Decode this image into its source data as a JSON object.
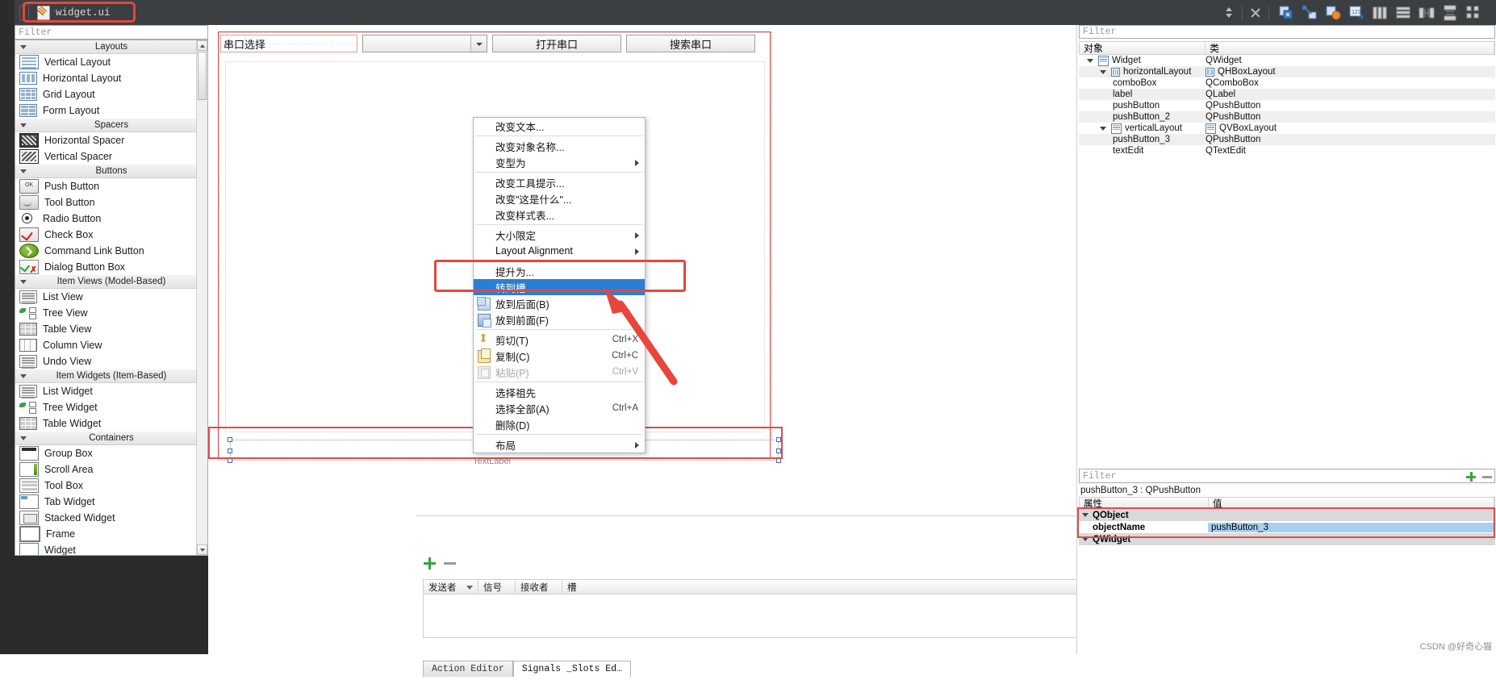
{
  "toolbar": {
    "file_name": "widget.ui",
    "icons": [
      "spin-updown",
      "close",
      "edit-widgets",
      "edit-signals-slots",
      "edit-buddies",
      "edit-tab-order",
      "layout-horizontal",
      "layout-vertical",
      "layout-splitter-h",
      "layout-splitter-v",
      "layout-grid",
      "layout-form",
      "break-layout"
    ]
  },
  "widget_box": {
    "filter_placeholder": "Filter",
    "groups": [
      {
        "title": "Layouts",
        "items": [
          {
            "label": "Vertical Layout",
            "icon": "vertical-layout-icon"
          },
          {
            "label": "Horizontal Layout",
            "icon": "horizontal-layout-icon"
          },
          {
            "label": "Grid Layout",
            "icon": "grid-layout-icon"
          },
          {
            "label": "Form Layout",
            "icon": "form-layout-icon"
          }
        ]
      },
      {
        "title": "Spacers",
        "items": [
          {
            "label": "Horizontal Spacer",
            "icon": "horizontal-spacer-icon"
          },
          {
            "label": "Vertical Spacer",
            "icon": "vertical-spacer-icon"
          }
        ]
      },
      {
        "title": "Buttons",
        "items": [
          {
            "label": "Push Button",
            "icon": "push-button-icon"
          },
          {
            "label": "Tool Button",
            "icon": "tool-button-icon"
          },
          {
            "label": "Radio Button",
            "icon": "radio-button-icon"
          },
          {
            "label": "Check Box",
            "icon": "check-box-icon"
          },
          {
            "label": "Command Link Button",
            "icon": "command-link-button-icon"
          },
          {
            "label": "Dialog Button Box",
            "icon": "dialog-button-box-icon"
          }
        ]
      },
      {
        "title": "Item Views (Model-Based)",
        "items": [
          {
            "label": "List View",
            "icon": "list-view-icon"
          },
          {
            "label": "Tree View",
            "icon": "tree-view-icon"
          },
          {
            "label": "Table View",
            "icon": "table-view-icon"
          },
          {
            "label": "Column View",
            "icon": "column-view-icon"
          },
          {
            "label": "Undo View",
            "icon": "undo-view-icon"
          }
        ]
      },
      {
        "title": "Item Widgets (Item-Based)",
        "items": [
          {
            "label": "List Widget",
            "icon": "list-widget-icon"
          },
          {
            "label": "Tree Widget",
            "icon": "tree-widget-icon"
          },
          {
            "label": "Table Widget",
            "icon": "table-widget-icon"
          }
        ]
      },
      {
        "title": "Containers",
        "items": [
          {
            "label": "Group Box",
            "icon": "group-box-icon"
          },
          {
            "label": "Scroll Area",
            "icon": "scroll-area-icon"
          },
          {
            "label": "Tool Box",
            "icon": "tool-box-icon"
          },
          {
            "label": "Tab Widget",
            "icon": "tab-widget-icon"
          },
          {
            "label": "Stacked Widget",
            "icon": "stacked-widget-icon"
          },
          {
            "label": "Frame",
            "icon": "frame-icon"
          },
          {
            "label": "Widget",
            "icon": "widget-icon"
          }
        ]
      }
    ]
  },
  "form": {
    "label_serial": "串口选择",
    "combo_value": "",
    "button_open": "打开串口",
    "button_search": "搜索串口",
    "bottom_label": "TextLabel"
  },
  "context_menu": {
    "items": [
      {
        "label": "改变文本...",
        "type": "item"
      },
      {
        "type": "separator"
      },
      {
        "label": "改变对象名称...",
        "type": "item"
      },
      {
        "label": "变型为",
        "type": "item",
        "submenu": true
      },
      {
        "type": "separator"
      },
      {
        "label": "改变工具提示...",
        "type": "item"
      },
      {
        "label": "改变\"这是什么\"...",
        "type": "item"
      },
      {
        "label": "改变样式表...",
        "type": "item"
      },
      {
        "type": "separator"
      },
      {
        "label": "大小限定",
        "type": "item",
        "submenu": true
      },
      {
        "label": "Layout Alignment",
        "type": "item",
        "submenu": true
      },
      {
        "type": "separator"
      },
      {
        "label": "提升为...",
        "type": "item"
      },
      {
        "label": "转到槽...",
        "type": "item",
        "selected": true
      },
      {
        "label": "放到后面(B)",
        "type": "item",
        "icon": "send-to-back-icon"
      },
      {
        "label": "放到前面(F)",
        "type": "item",
        "icon": "bring-to-front-icon"
      },
      {
        "type": "separator"
      },
      {
        "label": "剪切(T)",
        "type": "item",
        "icon": "cut-icon",
        "shortcut": "Ctrl+X"
      },
      {
        "label": "复制(C)",
        "type": "item",
        "icon": "copy-icon",
        "shortcut": "Ctrl+C"
      },
      {
        "label": "粘贴(P)",
        "type": "item",
        "icon": "paste-icon",
        "shortcut": "Ctrl+V",
        "disabled": true
      },
      {
        "type": "separator"
      },
      {
        "label": "选择祖先",
        "type": "item"
      },
      {
        "label": "选择全部(A)",
        "type": "item",
        "shortcut": "Ctrl+A"
      },
      {
        "label": "删除(D)",
        "type": "item"
      },
      {
        "type": "separator"
      },
      {
        "label": "布局",
        "type": "item",
        "submenu": true
      }
    ]
  },
  "signal_slot_editor": {
    "columns": [
      "发送者",
      "信号",
      "接收者",
      "槽"
    ],
    "rows": [],
    "tabs": [
      {
        "label": "Action Editor",
        "active": false
      },
      {
        "label": "Signals _Slots Ed…",
        "active": true
      }
    ]
  },
  "object_inspector": {
    "filter_placeholder": "Filter",
    "columns": [
      "对象",
      "类"
    ],
    "rows": [
      {
        "name": "Widget",
        "class": "QWidget",
        "indent": 0,
        "twisty": true,
        "icon": "vertical-layout-icon",
        "class_icon": ""
      },
      {
        "name": "horizontalLayout",
        "class": "QHBoxLayout",
        "indent": 1,
        "twisty": true,
        "icon": "horizontal-layout-icon",
        "class_icon": "horizontal-layout-icon"
      },
      {
        "name": "comboBox",
        "class": "QComboBox",
        "indent": 2,
        "twisty": false,
        "icon": "",
        "class_icon": ""
      },
      {
        "name": "label",
        "class": "QLabel",
        "indent": 2,
        "twisty": false,
        "icon": "",
        "class_icon": ""
      },
      {
        "name": "pushButton",
        "class": "QPushButton",
        "indent": 2,
        "twisty": false,
        "icon": "",
        "class_icon": ""
      },
      {
        "name": "pushButton_2",
        "class": "QPushButton",
        "indent": 2,
        "twisty": false,
        "icon": "",
        "class_icon": ""
      },
      {
        "name": "verticalLayout",
        "class": "QVBoxLayout",
        "indent": 1,
        "twisty": true,
        "icon": "vertical-layout-icon",
        "class_icon": "vertical-layout-icon"
      },
      {
        "name": "pushButton_3",
        "class": "QPushButton",
        "indent": 2,
        "twisty": false,
        "icon": "",
        "class_icon": ""
      },
      {
        "name": "textEdit",
        "class": "QTextEdit",
        "indent": 2,
        "twisty": false,
        "icon": "",
        "class_icon": ""
      }
    ]
  },
  "property_editor": {
    "filter_placeholder": "Filter",
    "selected_object": "pushButton_3 : QPushButton",
    "columns": [
      "属性",
      "值"
    ],
    "rows": [
      {
        "name": "QObject",
        "value": "",
        "group": true
      },
      {
        "name": "objectName",
        "value": "pushButton_3",
        "selected": true
      },
      {
        "name": "QWidget",
        "value": "",
        "group": true
      }
    ]
  },
  "watermark": "CSDN @好奇心猫",
  "colors": {
    "toolbar_bg": "#3c3f41",
    "menu_highlight": "#2a7fd4",
    "annotation_red": "#e8453c",
    "property_selected": "#a8d0f0"
  }
}
